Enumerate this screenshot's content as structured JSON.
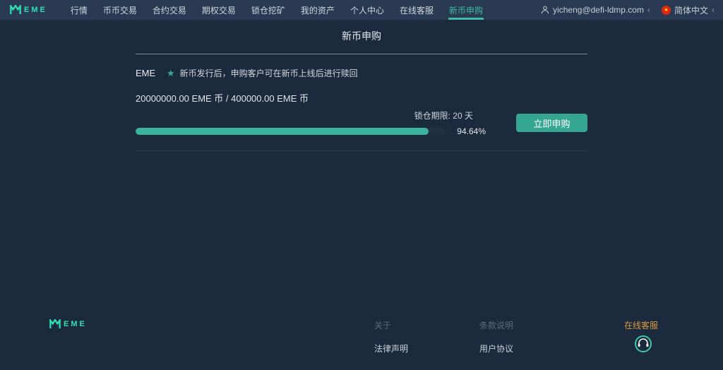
{
  "colors": {
    "accent_teal": "#35a691",
    "progress_fill": "#3ab49e",
    "navbar_bg": "#2a3a52",
    "body_bg": "#1c2a3d",
    "support_orange": "#d79b3e",
    "flag_red": "#de2910"
  },
  "icons": {
    "star": "★",
    "chevron": "‹",
    "flag_star": "★"
  },
  "navbar": {
    "logo_text": "EME",
    "items": [
      {
        "label": "行情",
        "active": false
      },
      {
        "label": "币币交易",
        "active": false
      },
      {
        "label": "合约交易",
        "active": false
      },
      {
        "label": "期权交易",
        "active": false
      },
      {
        "label": "锁仓挖矿",
        "active": false
      },
      {
        "label": "我的资产",
        "active": false
      },
      {
        "label": "个人中心",
        "active": false
      },
      {
        "label": "在线客服",
        "active": false
      },
      {
        "label": "新币申购",
        "active": true
      }
    ],
    "user_email": "yicheng@defi-ldmp.com",
    "language": "简体中文"
  },
  "page": {
    "title": "新币申购"
  },
  "subscription": {
    "coin": "EME",
    "notice": "新币发行后，申购客户可在新币上线后进行赎回",
    "amounts": "20000000.00 EME 币 / 400000.00 EME 币",
    "lock_period_label": "锁仓期限: 20 天",
    "progress_percent_label": "94.64%",
    "progress_value": 94.64,
    "subscribe_button": "立即申购"
  },
  "footer": {
    "logo_text": "EME",
    "about_heading": "关于",
    "about_link": "法律声明",
    "terms_heading": "条款说明",
    "terms_link": "用户协议",
    "support_label": "在线客服"
  }
}
